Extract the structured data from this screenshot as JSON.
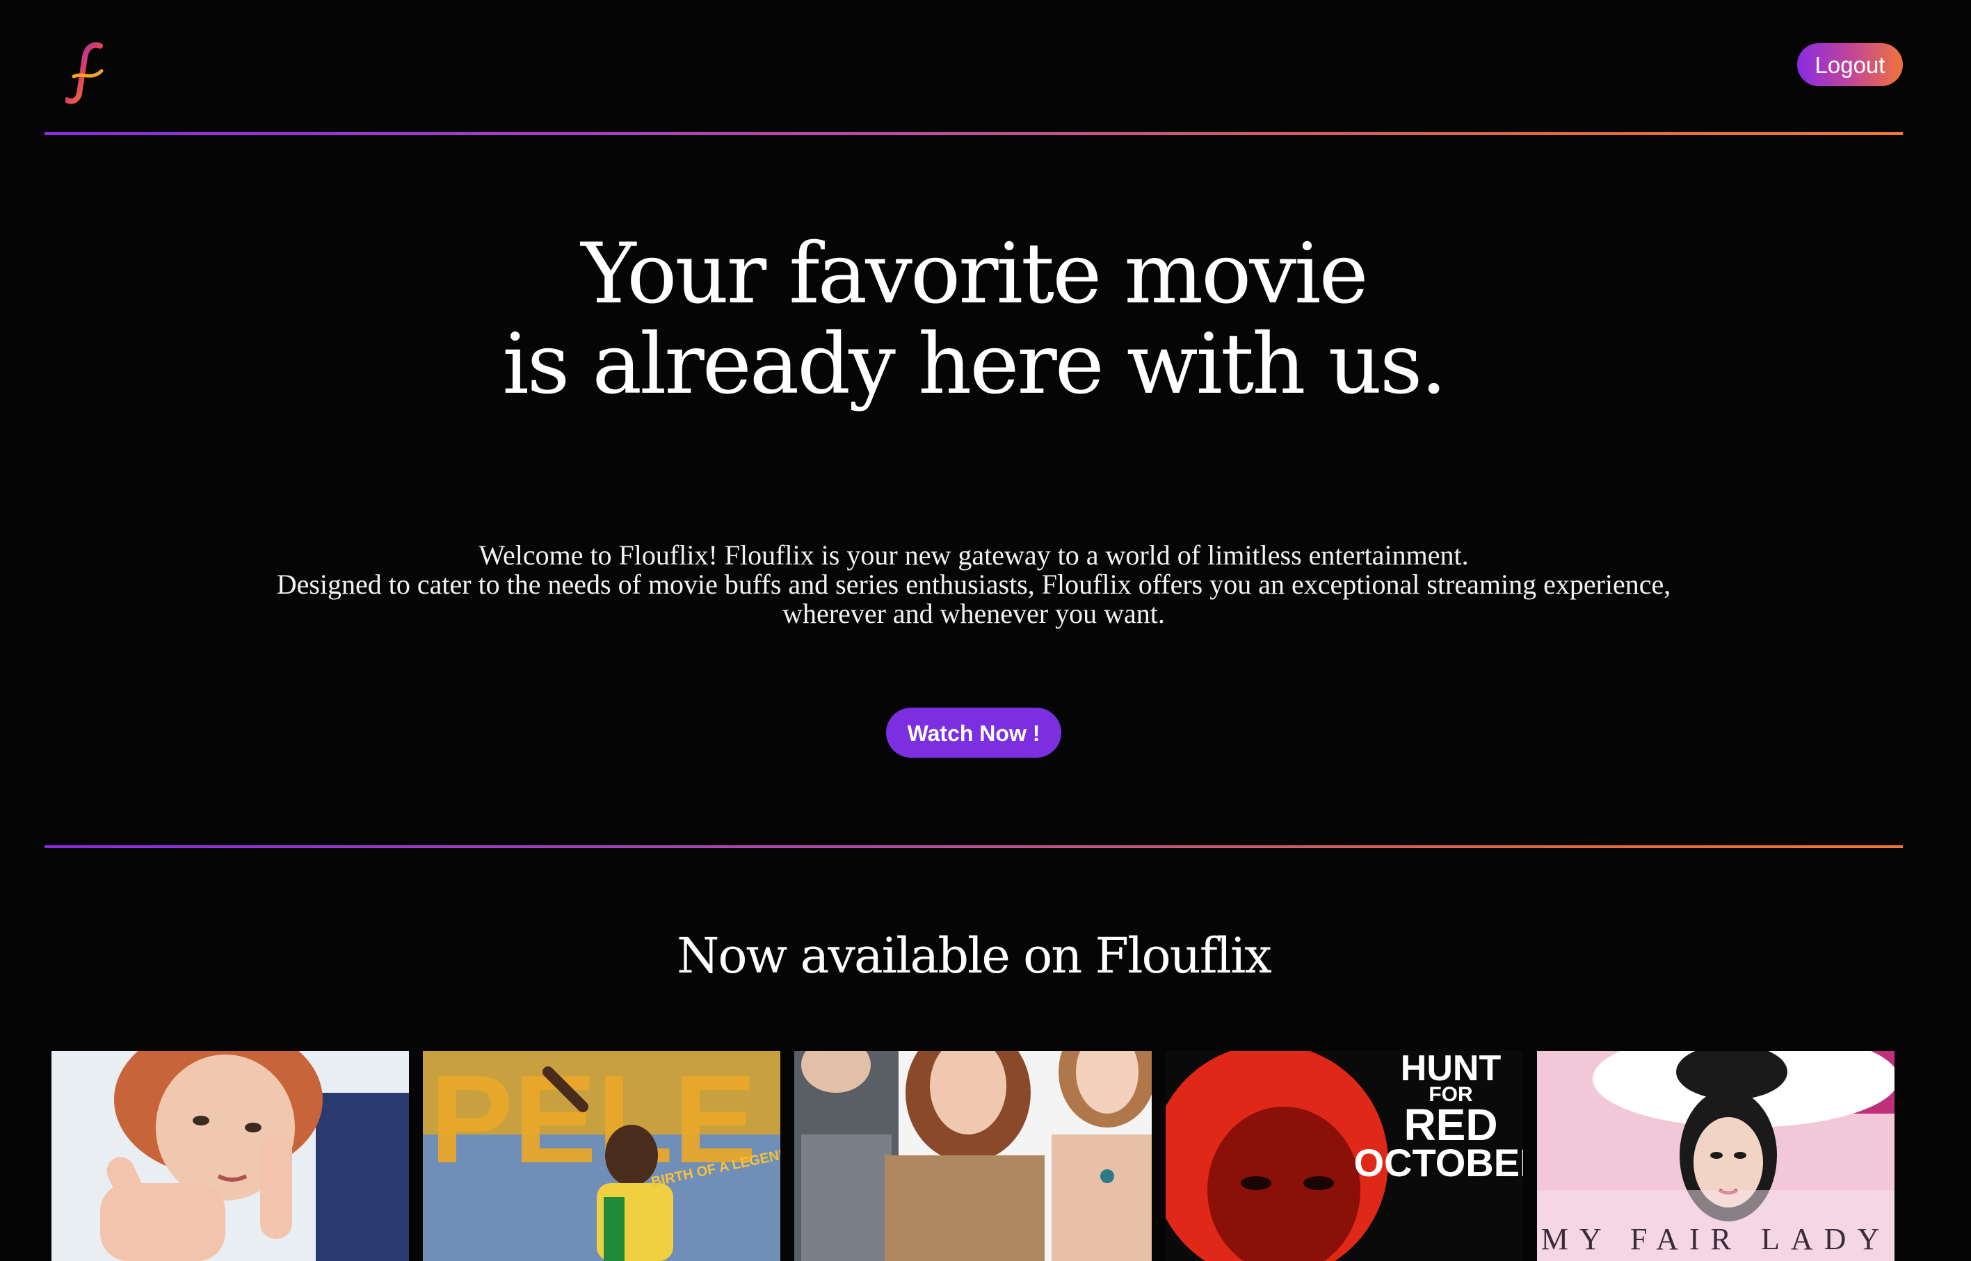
{
  "header": {
    "logo_letter": "f",
    "logout_label": "Logout"
  },
  "hero": {
    "title_line1": "Your favorite movie",
    "title_line2": "is already here with us.",
    "text_line1": "Welcome to Flouflix! Flouflix is your new gateway to a world of limitless entertainment.",
    "text_line2": "Designed to cater to the needs of movie buffs and series enthusiasts, Flouflix offers you an exceptional streaming experience,",
    "text_line3": "wherever and whenever you want.",
    "cta_label": "Watch Now !"
  },
  "now_available": {
    "title": "Now available on Flouflix",
    "posters": [
      {
        "name": "woman-hand-sign-poster",
        "text": ""
      },
      {
        "name": "pele-poster",
        "title": "PELE",
        "tagline": "BIRTH OF A LEGEND"
      },
      {
        "name": "three-women-poster",
        "text": ""
      },
      {
        "name": "hunt-for-red-october-poster",
        "line1": "HUNT",
        "line2": "FOR",
        "line3": "RED",
        "line4": "OCTOBER"
      },
      {
        "name": "my-fair-lady-poster",
        "title": "MY FAIR LADY"
      }
    ]
  },
  "colors": {
    "background": "#050505",
    "accent_purple": "#8a2be2",
    "accent_orange": "#f07a30",
    "cta_purple": "#7b2fe0"
  }
}
